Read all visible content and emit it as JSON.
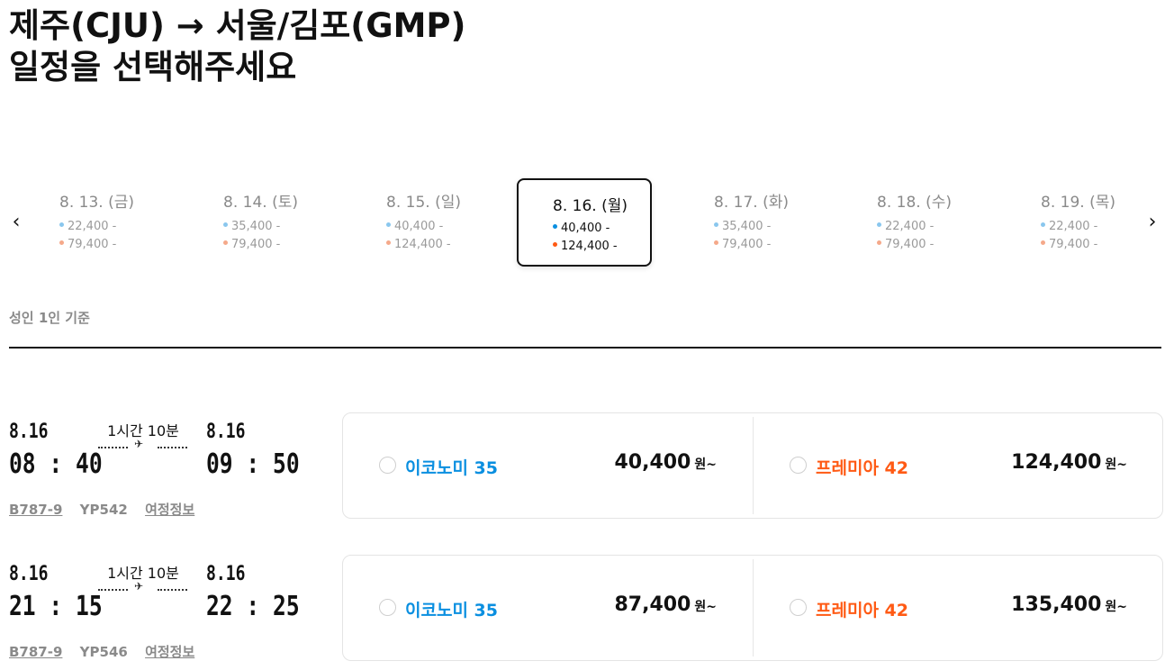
{
  "header": {
    "route_line": "제주(CJU) → 서울/김포(GMP)",
    "subtitle": "일정을 선택해주세요"
  },
  "date_nav": {
    "prev_icon": "chevron-left-icon",
    "next_icon": "chevron-right-icon",
    "prev_glyph": "‹",
    "next_glyph": "›",
    "dates": [
      {
        "label": "8. 13. (금)",
        "economy": "22,400 -",
        "premia": "79,400 -",
        "selected": false
      },
      {
        "label": "8. 14. (토)",
        "economy": "35,400 -",
        "premia": "79,400 -",
        "selected": false
      },
      {
        "label": "8. 15. (일)",
        "economy": "40,400 -",
        "premia": "124,400 -",
        "selected": false
      },
      {
        "label": "8. 16. (월)",
        "economy": "40,400 -",
        "premia": "124,400 -",
        "selected": true
      },
      {
        "label": "8. 17. (화)",
        "economy": "35,400 -",
        "premia": "79,400 -",
        "selected": false
      },
      {
        "label": "8. 18. (수)",
        "economy": "22,400 -",
        "premia": "79,400 -",
        "selected": false
      },
      {
        "label": "8. 19. (목)",
        "economy": "22,400 -",
        "premia": "79,400 -",
        "selected": false
      }
    ]
  },
  "basis_note": "성인 1인 기준",
  "colors": {
    "economy": "#0a8fe0",
    "premia": "#ff5a14",
    "economy_light": "#8ac7ee",
    "premia_light": "#f5a98a"
  },
  "flights": [
    {
      "dep_date": "8.16",
      "dep_time": "08 : 40",
      "arr_date": "8.16",
      "arr_time": "09 : 50",
      "duration": "1시간 10분",
      "aircraft": "B787-9",
      "flight_no": "YP542",
      "itinerary_link": "여정정보",
      "economy": {
        "class_label": "이코노미 35",
        "price": "40,400",
        "unit": "원~"
      },
      "premia": {
        "class_label": "프레미아 42",
        "price": "124,400",
        "unit": "원~"
      }
    },
    {
      "dep_date": "8.16",
      "dep_time": "21 : 15",
      "arr_date": "8.16",
      "arr_time": "22 : 25",
      "duration": "1시간 10분",
      "aircraft": "B787-9",
      "flight_no": "YP546",
      "itinerary_link": "여정정보",
      "economy": {
        "class_label": "이코노미 35",
        "price": "87,400",
        "unit": "원~"
      },
      "premia": {
        "class_label": "프레미아 42",
        "price": "135,400",
        "unit": "원~"
      }
    }
  ]
}
